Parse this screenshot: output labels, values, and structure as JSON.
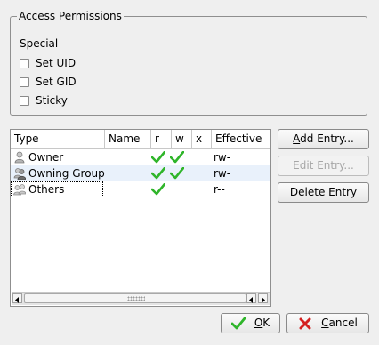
{
  "access_permissions": {
    "title": "Access Permissions",
    "special_label": "Special",
    "options": [
      {
        "label": "Set UID",
        "checked": false
      },
      {
        "label": "Set GID",
        "checked": false
      },
      {
        "label": "Sticky",
        "checked": false
      }
    ]
  },
  "table": {
    "columns": [
      "Type",
      "Name",
      "r",
      "w",
      "x",
      "Effective"
    ],
    "rows": [
      {
        "type": "Owner",
        "name": "",
        "r": true,
        "w": true,
        "x": false,
        "effective": "rw-",
        "icon": "user-icon"
      },
      {
        "type": "Owning Group",
        "name": "",
        "r": true,
        "w": true,
        "x": false,
        "effective": "rw-",
        "icon": "group-icon"
      },
      {
        "type": "Others",
        "name": "",
        "r": true,
        "w": false,
        "x": false,
        "effective": "r--",
        "icon": "others-icon"
      }
    ]
  },
  "buttons": {
    "add_entry": {
      "mnemonic": "A",
      "rest": "dd Entry..."
    },
    "edit_entry": {
      "label": "Edit Entry...",
      "disabled": true
    },
    "delete_entry": {
      "mnemonic": "D",
      "rest": "elete Entry"
    },
    "ok": {
      "mnemonic": "O",
      "rest": "K"
    },
    "cancel": {
      "mnemonic": "C",
      "rest": "ancel"
    }
  },
  "colors": {
    "check_green": "#2fb52a",
    "cancel_red": "#d42020",
    "row_highlight": "#e9f1fb"
  }
}
